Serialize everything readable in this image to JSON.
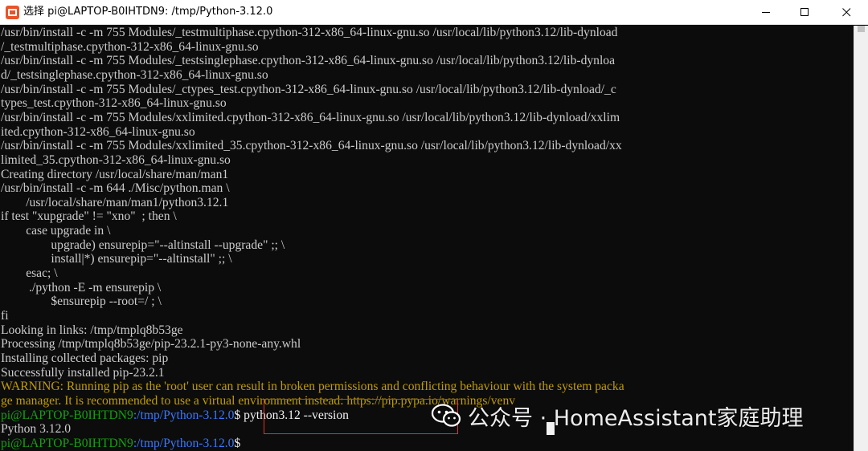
{
  "window": {
    "title": "选择 pi@LAPTOP-B0IHTDN9: /tmp/Python-3.12.0",
    "controls": {
      "minimize_icon": "minimize-icon",
      "maximize_icon": "maximize-icon",
      "close_icon": "close-icon"
    }
  },
  "terminal": {
    "lines": [
      {
        "text": "/usr/bin/install -c -m 755 Modules/_testmultiphase.cpython-312-x86_64-linux-gnu.so /usr/local/lib/python3.12/lib-dynload"
      },
      {
        "text": "/_testmultiphase.cpython-312-x86_64-linux-gnu.so"
      },
      {
        "text": "/usr/bin/install -c -m 755 Modules/_testsinglephase.cpython-312-x86_64-linux-gnu.so /usr/local/lib/python3.12/lib-dynloa"
      },
      {
        "text": "d/_testsinglephase.cpython-312-x86_64-linux-gnu.so"
      },
      {
        "text": "/usr/bin/install -c -m 755 Modules/_ctypes_test.cpython-312-x86_64-linux-gnu.so /usr/local/lib/python3.12/lib-dynload/_c"
      },
      {
        "text": "types_test.cpython-312-x86_64-linux-gnu.so"
      },
      {
        "text": "/usr/bin/install -c -m 755 Modules/xxlimited.cpython-312-x86_64-linux-gnu.so /usr/local/lib/python3.12/lib-dynload/xxlim"
      },
      {
        "text": "ited.cpython-312-x86_64-linux-gnu.so"
      },
      {
        "text": "/usr/bin/install -c -m 755 Modules/xxlimited_35.cpython-312-x86_64-linux-gnu.so /usr/local/lib/python3.12/lib-dynload/xx"
      },
      {
        "text": "limited_35.cpython-312-x86_64-linux-gnu.so"
      },
      {
        "text": "Creating directory /usr/local/share/man/man1"
      },
      {
        "text": "/usr/bin/install -c -m 644 ./Misc/python.man \\"
      },
      {
        "text": "        /usr/local/share/man/man1/python3.12.1"
      },
      {
        "text": "if test \"xupgrade\" != \"xno\"  ; then \\"
      },
      {
        "text": "        case upgrade in \\"
      },
      {
        "text": "                upgrade) ensurepip=\"--altinstall --upgrade\" ;; \\"
      },
      {
        "text": "                install|*) ensurepip=\"--altinstall\" ;; \\"
      },
      {
        "text": "        esac; \\"
      },
      {
        "text": "         ./python -E -m ensurepip \\"
      },
      {
        "text": "                $ensurepip --root=/ ; \\"
      },
      {
        "text": "fi"
      },
      {
        "text": "Looking in links: /tmp/tmplq8b53ge"
      },
      {
        "text": "Processing /tmp/tmplq8b53ge/pip-23.2.1-py3-none-any.whl"
      },
      {
        "text": "Installing collected packages: pip"
      },
      {
        "text": "Successfully installed pip-23.2.1"
      },
      {
        "text": "WARNING: Running pip as the 'root' user can result in broken permissions and conflicting behaviour with the system packa",
        "style": "warn"
      },
      {
        "text": "ge manager. It is recommended to use a virtual environment instead: https://pip.pypa.io/warnings/venv",
        "style": "warn"
      }
    ],
    "prompt1": {
      "user": "pi@LAPTOP-B0IHTDN9",
      "path": ":/tmp/Python-3.12.0",
      "dollar": "$",
      "command": " python3.12 --version"
    },
    "output1": "Python 3.12.0",
    "prompt2": {
      "user": "pi@LAPTOP-B0IHTDN9",
      "path": ":/tmp/Python-3.12.0",
      "dollar": "$"
    }
  },
  "watermark": {
    "icon": "wechat-icon",
    "text": "公众号 · HomeAssistant家庭助理"
  },
  "colors": {
    "background": "#0c0c0c",
    "foreground": "#cccccc",
    "warning": "#c19c00",
    "prompt_user": "#13a10e",
    "prompt_path": "#3b78ff",
    "highlight_box": "#e0302a"
  }
}
